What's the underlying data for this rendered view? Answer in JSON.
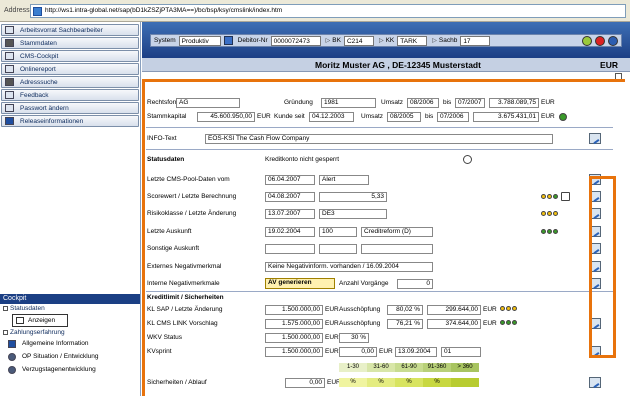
{
  "browser": {
    "address_label": "Address",
    "url": "http://ws1.intra-global.net/sap(bD1kZSZjPTA3MA==)/bc/bsp/ksy/cmslink/index.htm"
  },
  "sidebar": {
    "items": [
      "Arbeitsvorrat Sachbearbeiter",
      "Stammdaten",
      "CMS-Cockpit",
      "Onlinereport",
      "Adresssuche",
      "Feedback",
      "Passwort ändern",
      "Releaseinformationen"
    ],
    "cockpit_title": "Cockpit",
    "statusdaten": "Statusdaten",
    "anzeigen": "Anzeigen",
    "zahlungserfahrung": "Zahlungserfahrung",
    "sub_items": [
      "Allgemeine Information",
      "OP Situation / Entwicklung",
      "Verzugstagenentwicklung"
    ]
  },
  "toolbar": {
    "system_label": "System",
    "system_value": "Produktiv",
    "debitor_label": "Debitor-Nr",
    "debitor_value": "0000072473",
    "bk_label": "BK",
    "bk_value": "C214",
    "kk_label": "KK",
    "kk_value": "TARK",
    "sachb_label": "Sachb",
    "sachb_value": "17"
  },
  "header": {
    "name": "Moritz Muster AG , DE-12345 Musterstadt",
    "currency": "EUR"
  },
  "company": {
    "rechtsform_label": "Rechtsform",
    "rechtsform_value": "AG",
    "gruendung_label": "Gründung",
    "gruendung_value": "1981",
    "umsatz_label": "Umsatz",
    "umsatz1_from": "08/2006",
    "bis_label": "bis",
    "umsatz1_to": "07/2007",
    "umsatz1_value": "3.788.089,75",
    "umsatz1_cur": "EUR",
    "stammkapital_label": "Stammkapital",
    "stammkapital_value": "45.600.950,00",
    "stammkapital_cur": "EUR",
    "kunde_seit_label": "Kunde seit",
    "kunde_seit_value": "04.12.2003",
    "umsatz2_from": "08/2005",
    "umsatz2_to": "07/2006",
    "umsatz2_value": "3.675.431,01",
    "umsatz2_cur": "EUR",
    "info_label": "INFO-Text",
    "info_value": "EOS-KSI The Cash Flow Company"
  },
  "status": {
    "title": "Statusdaten",
    "kreditkonto": "Kreditkonto nicht gesperrt",
    "rows": [
      {
        "label": "Letzte CMS-Pool-Daten vom",
        "v1": "06.04.2007",
        "v2": "Alert"
      },
      {
        "label": "Scorewert / Letzte Berechnung",
        "v1": "04.08.2007",
        "v2": "5,33"
      },
      {
        "label": "Risikoklasse / Letzte Änderung",
        "v1": "13.07.2007",
        "v2": "DE3"
      },
      {
        "label": "Letzte Auskunft",
        "v1": "19.02.2004",
        "v2": "100",
        "v3": "Creditreform (D)"
      },
      {
        "label": "Sonstige Auskunft",
        "v1": "",
        "v2": ""
      },
      {
        "label": "Externes Negativmerkmal",
        "v1": "Keine Negativinform. vorhanden / 16.09.2004"
      },
      {
        "label": "Interne Negativmerkmale",
        "button": "AV generieren",
        "anzahl_label": "Anzahl Vorgänge",
        "anzahl_value": "0"
      }
    ]
  },
  "kredit": {
    "title": "Kreditlimit / Sicherheiten",
    "rows": [
      {
        "label": "KL SAP / Letzte Änderung",
        "v1": "1.500.000,00",
        "cur": "EUR",
        "aus_label": "Ausschöpfung",
        "pct": "80,02 %",
        "v2": "299.644,00",
        "cur2": "EUR"
      },
      {
        "label": "KL CMS LINK Vorschlag",
        "v1": "1.575.000,00",
        "cur": "EUR",
        "aus_label": "Ausschöpfung",
        "pct": "76,21 %",
        "v2": "374.644,00",
        "cur2": "EUR"
      },
      {
        "label": "WKV Status",
        "v1": "1.500.000,00",
        "cur": "EUR",
        "pct": "30 %"
      },
      {
        "label": "KVsprint",
        "v1": "1.500.000,00",
        "cur": "EUR",
        "v2": "0,00",
        "cur2": "EUR",
        "date": "13.09.2004",
        "code": "01"
      }
    ],
    "dist_headers": [
      "1-30",
      "31-60",
      "61-90",
      "91-360",
      "> 360"
    ],
    "dist_values": [
      "%",
      "%",
      "%",
      "%",
      ""
    ],
    "sicherheiten_label": "Sicherheiten / Ablauf",
    "sicherheiten_value": "0,00",
    "sicherheiten_cur": "EUR"
  },
  "colors": {
    "accent_orange": "#e8730c",
    "header_blue": "#1d3f85"
  }
}
